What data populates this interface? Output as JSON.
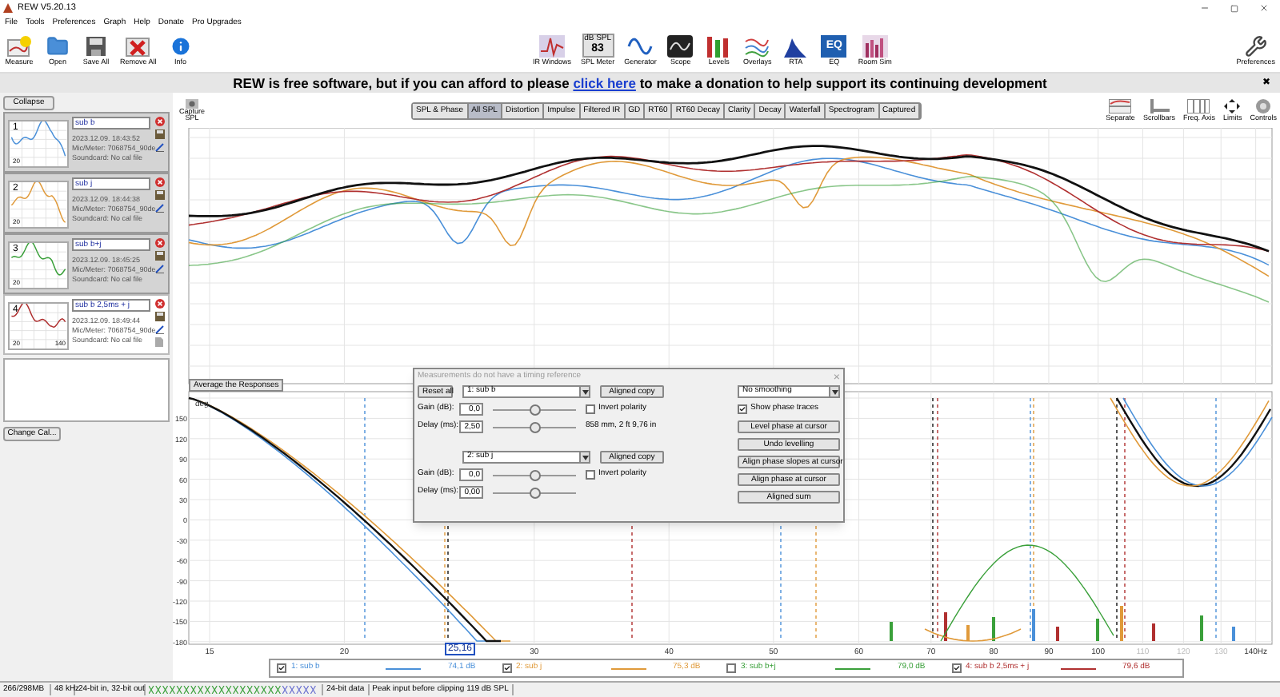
{
  "window": {
    "title": "REW V5.20.13"
  },
  "menu": [
    "File",
    "Tools",
    "Preferences",
    "Graph",
    "Help",
    "Donate",
    "Pro Upgrades"
  ],
  "toolbar_left": [
    {
      "label": "Measure"
    },
    {
      "label": "Open"
    },
    {
      "label": "Save All"
    },
    {
      "label": "Remove All"
    },
    {
      "label": "Info"
    }
  ],
  "toolbar_right": [
    {
      "label": "IR Windows"
    },
    {
      "label": "SPL Meter",
      "meter_unit": "dB SPL",
      "meter_reading": "83"
    },
    {
      "label": "Generator"
    },
    {
      "label": "Scope"
    },
    {
      "label": "Levels"
    },
    {
      "label": "Overlays"
    },
    {
      "label": "RTA"
    },
    {
      "label": "EQ",
      "badge": "EQ"
    },
    {
      "label": "Room Sim"
    }
  ],
  "preferences": {
    "label": "Preferences"
  },
  "banner": {
    "text_before": "REW is free software, but if you can afford to please",
    "link": "click here",
    "text_after": "to make a donation to help support its continuing development",
    "close": "✖"
  },
  "collapse_button": "Collapse",
  "measurements": [
    {
      "number": "1",
      "name": "sub b",
      "date": "2023.12.09. 18:43:52",
      "mic": "Mic/Meter: 7068754_90de",
      "soundcard": "Soundcard: No cal file",
      "color": "#4a90d9",
      "selected": false,
      "x_min": "20"
    },
    {
      "number": "2",
      "name": "sub j",
      "date": "2023.12.09. 18:44:38",
      "mic": "Mic/Meter: 7068754_90de",
      "soundcard": "Soundcard: No cal file",
      "color": "#e09a3a",
      "selected": false,
      "x_min": "20"
    },
    {
      "number": "3",
      "name": "sub b+j",
      "date": "2023.12.09. 18:45:25",
      "mic": "Mic/Meter: 7068754_90de",
      "soundcard": "Soundcard: No cal file",
      "color": "#3aa03a",
      "selected": false,
      "x_min": "20"
    },
    {
      "number": "4",
      "name": "sub b 2,5ms + j",
      "date": "2023.12.09. 18:49:44",
      "mic": "Mic/Meter: 7068754_90de",
      "soundcard": "Soundcard: No cal file",
      "color": "#b03030",
      "selected": true,
      "x_min": "20",
      "x_max": "140"
    }
  ],
  "change_cal_button": "Change Cal...",
  "capture": {
    "label": "Capture",
    "sub_label": "SPL"
  },
  "tabs": [
    {
      "label": "SPL & Phase",
      "selected": false
    },
    {
      "label": "All SPL",
      "selected": true
    },
    {
      "label": "Distortion",
      "selected": false
    },
    {
      "label": "Impulse",
      "selected": false
    },
    {
      "label": "Filtered IR",
      "selected": false
    },
    {
      "label": "GD",
      "selected": false
    },
    {
      "label": "RT60",
      "selected": false
    },
    {
      "label": "RT60 Decay",
      "selected": false
    },
    {
      "label": "Clarity",
      "selected": false
    },
    {
      "label": "Decay",
      "selected": false
    },
    {
      "label": "Waterfall",
      "selected": false
    },
    {
      "label": "Spectrogram",
      "selected": false
    },
    {
      "label": "Captured",
      "selected": false
    }
  ],
  "graph_tools": [
    "Separate",
    "Scrollbars",
    "Freq. Axis",
    "Limits",
    "Controls"
  ],
  "average_button": "Average the Responses",
  "phase_axis": {
    "unit": "deg",
    "ticks": [
      "150",
      "120",
      "90",
      "60",
      "30",
      "0",
      "-30",
      "-60",
      "-90",
      "-120",
      "-150",
      "-180"
    ]
  },
  "x_axis": [
    {
      "label": "15",
      "muted": false
    },
    {
      "label": "20",
      "muted": false
    },
    {
      "label": "30",
      "muted": false
    },
    {
      "label": "40",
      "muted": false
    },
    {
      "label": "50",
      "muted": false
    },
    {
      "label": "60",
      "muted": false
    },
    {
      "label": "70",
      "muted": false
    },
    {
      "label": "80",
      "muted": false
    },
    {
      "label": "90",
      "muted": false
    },
    {
      "label": "100",
      "muted": false
    },
    {
      "label": "110",
      "muted": true
    },
    {
      "label": "120",
      "muted": true
    },
    {
      "label": "130",
      "muted": true
    },
    {
      "label": "140Hz",
      "muted": false
    }
  ],
  "cursor_readout": "25,16",
  "dialog": {
    "title": "Measurements do not have a timing reference",
    "close": "×",
    "reset_button": "Reset all",
    "channels": [
      {
        "select": "1: sub b",
        "copy_button": "Aligned copy",
        "gain_label": "Gain (dB):",
        "gain": "0,0",
        "gain_slider": {
          "level": 0.5
        },
        "invert_label": "Invert polarity",
        "invert_checked": false,
        "delay_label": "Delay (ms):",
        "delay": "2,50",
        "delay_slider": {
          "level": 0.5
        },
        "distance": "858 mm, 2 ft 9,76 in"
      },
      {
        "select": "2: sub j",
        "copy_button": "Aligned copy",
        "gain_label": "Gain (dB):",
        "gain": "0,0",
        "gain_slider": {
          "level": 0.5
        },
        "invert_label": "Invert polarity",
        "invert_checked": false,
        "delay_label": "Delay (ms):",
        "delay": "0,00",
        "delay_slider": {
          "level": 0.5
        }
      }
    ],
    "smoothing": "No smoothing",
    "show_phase_label": "Show phase traces",
    "show_phase_checked": true,
    "buttons": [
      "Level phase at cursor",
      "Undo levelling",
      "Align phase slopes at cursor",
      "Align phase at cursor",
      "Aligned sum"
    ]
  },
  "legend": [
    {
      "label": "1: sub b",
      "value": "74,1 dB",
      "color": "#4a90d9",
      "checked": true
    },
    {
      "label": "2: sub j",
      "value": "75,3 dB",
      "color": "#e09a3a",
      "checked": true
    },
    {
      "label": "3: sub b+j",
      "value": "79,0 dB",
      "color": "#3aa03a",
      "checked": false
    },
    {
      "label": "4: sub b 2,5ms + j",
      "value": "79,6 dB",
      "color": "#b03030",
      "checked": true
    }
  ],
  "status_bar": {
    "memory": "266/298MB",
    "rate": "48 kHz",
    "bits": "24-bit in, 32-bit out",
    "data": "24-bit data",
    "peak": "Peak input before clipping 119 dB SPL"
  }
}
